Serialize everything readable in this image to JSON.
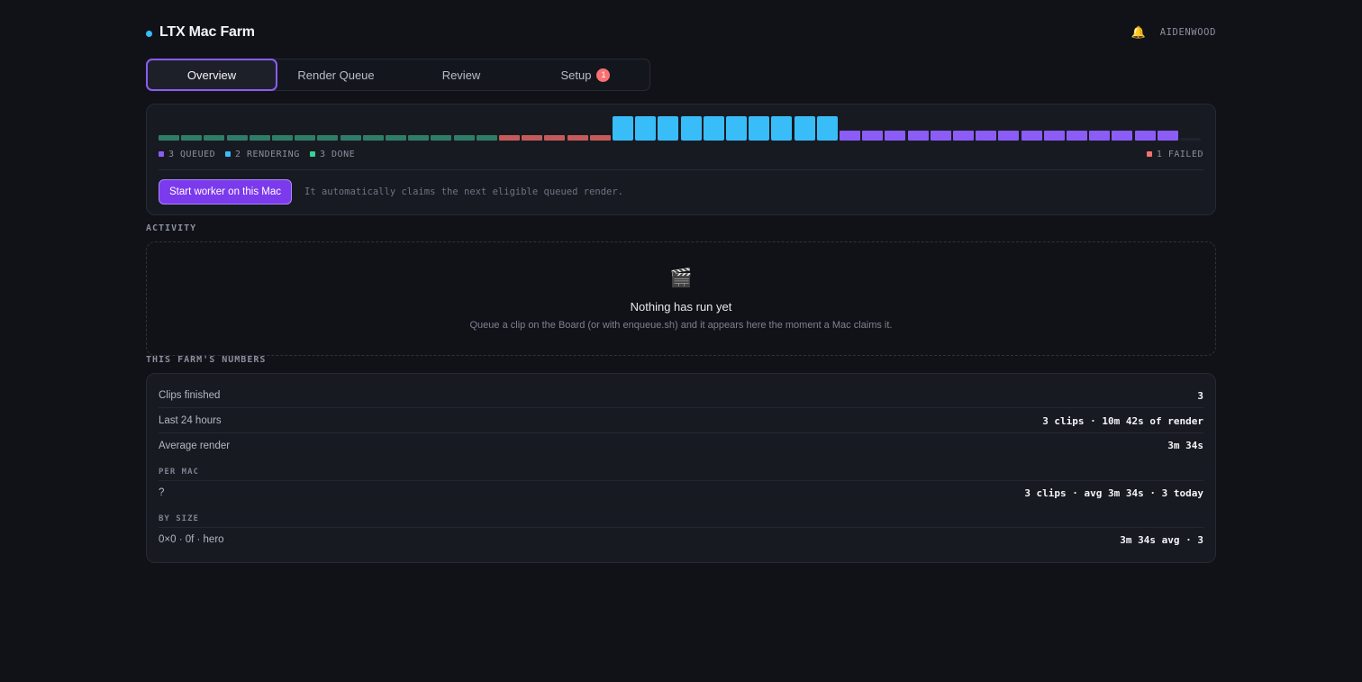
{
  "header": {
    "app_title": "LTX Mac Farm",
    "username": "AIDENWOOD",
    "bell_icon": "🔔"
  },
  "tabs": [
    {
      "label": "Overview",
      "active": true
    },
    {
      "label": "Render Queue",
      "active": false
    },
    {
      "label": "Review",
      "active": false
    },
    {
      "label": "Setup",
      "active": false,
      "badge": "1"
    }
  ],
  "timeline": {
    "segments": [
      {
        "status": "done",
        "count": 15,
        "color": "#2f7d67"
      },
      {
        "status": "failed",
        "count": 5,
        "color": "#c45b5b"
      },
      {
        "status": "rendering",
        "count": 10,
        "color": "#38bdf8"
      },
      {
        "status": "queued",
        "count": 15,
        "color": "#8b5cf6"
      },
      {
        "status": "empty",
        "count": 1,
        "color": "#1f2230"
      }
    ]
  },
  "legend": {
    "queued": {
      "text": "3 QUEUED",
      "color": "#8b5cf6"
    },
    "rendering": {
      "text": "2 RENDERING",
      "color": "#38bdf8"
    },
    "done": {
      "text": "3 DONE",
      "color": "#34d399"
    },
    "failed": {
      "text": "1 FAILED",
      "color": "#f87171"
    }
  },
  "worker": {
    "button_label": "Start worker on this Mac",
    "hint": "It automatically claims the next eligible queued render."
  },
  "activity": {
    "label": "ACTIVITY",
    "icon": "🎬",
    "empty_title": "Nothing has run yet",
    "empty_sub": "Queue a clip on the Board (or with enqueue.sh) and it appears here the moment a Mac claims it."
  },
  "numbers": {
    "label": "THIS FARM'S NUMBERS",
    "clips_finished": {
      "label": "Clips finished",
      "value": "3"
    },
    "last_24h": {
      "label": "Last 24 hours",
      "value": "3 clips · 10m 42s of render"
    },
    "avg_render": {
      "label": "Average render",
      "value": "3m 34s"
    },
    "per_mac_label": "PER MAC",
    "per_mac_row": {
      "label": "?",
      "value": "3 clips · avg 3m 34s · 3 today"
    },
    "by_size_label": "BY SIZE",
    "by_size_row": {
      "label": "0×0 · 0f · hero",
      "value": "3m 34s avg · 3"
    }
  }
}
